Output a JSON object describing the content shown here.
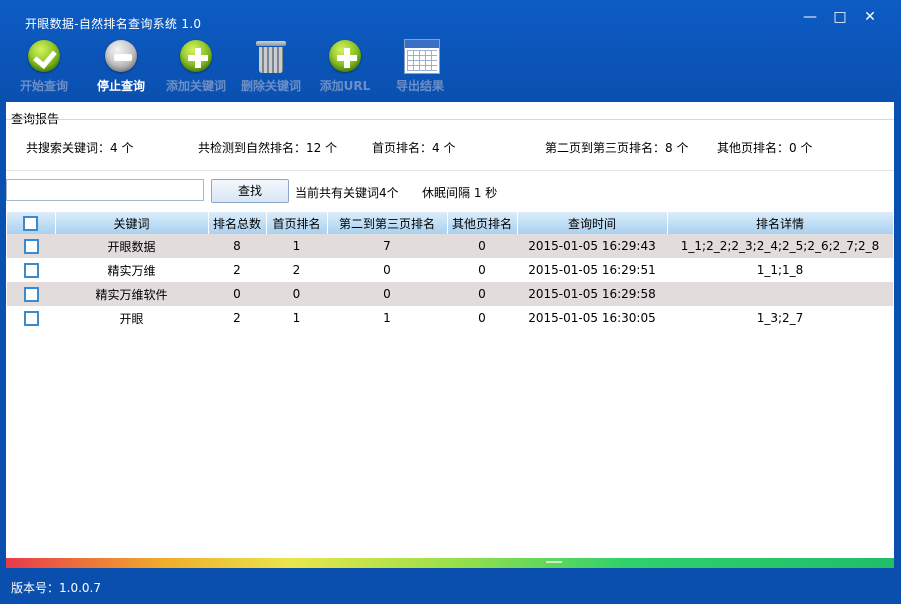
{
  "window": {
    "title": "开眼数据-自然排名查询系统 1.0",
    "min": "—",
    "max": "□",
    "close": "✕"
  },
  "toolbar": [
    {
      "label": "开始查询",
      "icon": "check-icon",
      "active": false
    },
    {
      "label": "停止查询",
      "icon": "stop-icon",
      "active": true
    },
    {
      "label": "添加关键词",
      "icon": "plus-icon",
      "active": false
    },
    {
      "label": "删除关键词",
      "icon": "trash-icon",
      "active": false
    },
    {
      "label": "添加URL",
      "icon": "plus-icon",
      "active": false
    },
    {
      "label": "导出结果",
      "icon": "calendar-icon",
      "active": false
    }
  ],
  "report": {
    "title": "查询报告",
    "stats": [
      "共搜索关键词：4 个",
      "共检测到自然排名：12 个",
      "首页排名：4 个",
      "第二页到第三页排名：8 个",
      "其他页排名：0 个"
    ]
  },
  "search": {
    "value": "",
    "button": "查找",
    "keyword_count": "当前共有关键词4个",
    "sleep": "休眠间隔 1 秒"
  },
  "table": {
    "columns": [
      "关键词",
      "排名总数",
      "首页排名",
      "第二到第三页排名",
      "其他页排名",
      "查询时间",
      "排名详情"
    ],
    "rows": [
      {
        "keyword": "开眼数据",
        "total": "8",
        "first": "1",
        "second_third": "7",
        "other": "0",
        "time": "2015-01-05 16:29:43",
        "detail": "1_1;2_2;2_3;2_4;2_5;2_6;2_7;2_8"
      },
      {
        "keyword": "精实万维",
        "total": "2",
        "first": "2",
        "second_third": "0",
        "other": "0",
        "time": "2015-01-05 16:29:51",
        "detail": "1_1;1_8"
      },
      {
        "keyword": "精实万维软件",
        "total": "0",
        "first": "0",
        "second_third": "0",
        "other": "0",
        "time": "2015-01-05 16:29:58",
        "detail": ""
      },
      {
        "keyword": "开眼",
        "total": "2",
        "first": "1",
        "second_third": "1",
        "other": "0",
        "time": "2015-01-05 16:30:05",
        "detail": "1_3;2_7"
      }
    ]
  },
  "footer": {
    "version": "版本号：1.0.0.7"
  }
}
